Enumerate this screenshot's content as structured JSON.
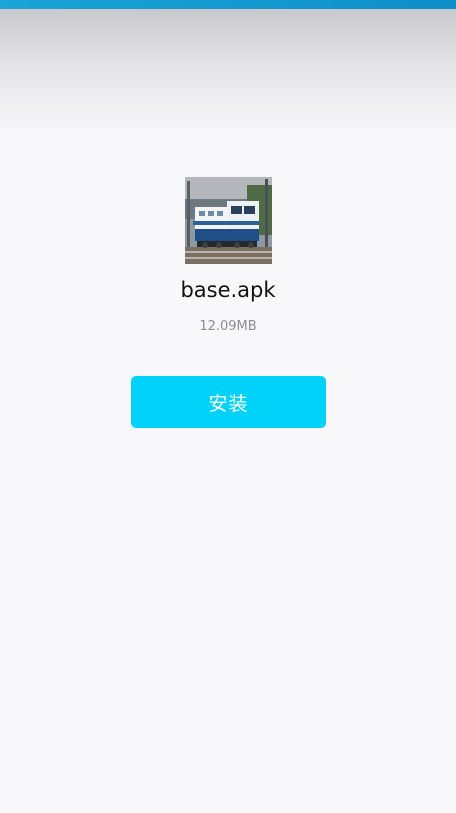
{
  "app": {
    "name": "base.apk",
    "size": "12.09MB",
    "icon": "locomotive-app-icon"
  },
  "actions": {
    "install_label": "安装"
  },
  "colors": {
    "status_bar": "#0d8fc9",
    "background": "#f8f7f9",
    "install_button": "#00d2fa"
  }
}
